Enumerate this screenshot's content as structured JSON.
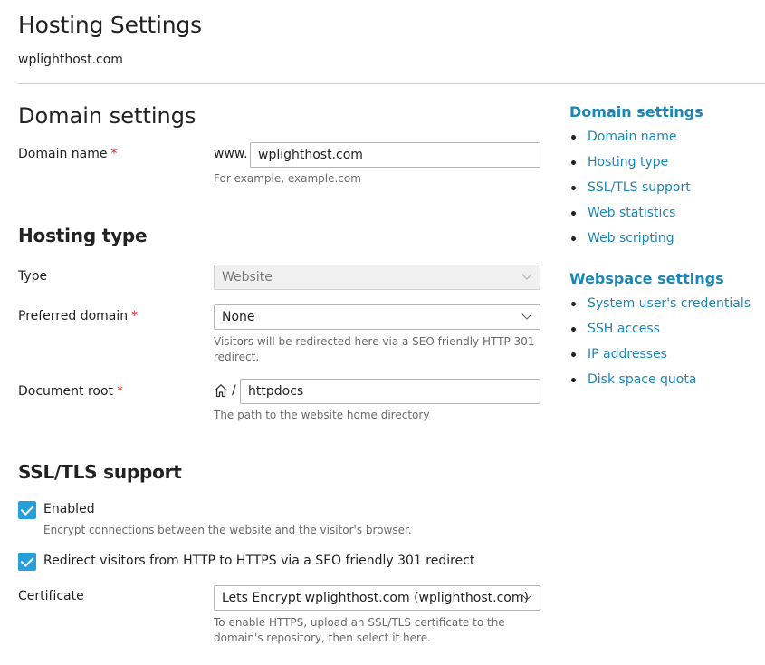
{
  "header": {
    "title": "Hosting Settings",
    "domain": "wplighthost.com"
  },
  "domain_settings": {
    "heading": "Domain settings",
    "domain_name_label": "Domain name",
    "required_mark": "*",
    "www_prefix": "www.",
    "domain_value": "wplighthost.com",
    "domain_hint": "For example, example.com"
  },
  "hosting_type": {
    "heading": "Hosting type",
    "type_label": "Type",
    "type_value": "Website",
    "preferred_label": "Preferred domain",
    "preferred_value": "None",
    "preferred_hint": "Visitors will be redirected here via a SEO friendly HTTP 301 redirect.",
    "docroot_label": "Document root",
    "docroot_slash": "/",
    "docroot_value": "httpdocs",
    "docroot_hint": "The path to the website home directory"
  },
  "ssl": {
    "heading": "SSL/TLS support",
    "enabled_label": "Enabled",
    "enabled_checked": true,
    "enabled_hint": "Encrypt connections between the website and the visitor's browser.",
    "redirect_label": "Redirect visitors from HTTP to HTTPS via a SEO friendly 301 redirect",
    "redirect_checked": true,
    "cert_label": "Certificate",
    "cert_value": "Lets Encrypt wplighthost.com (wplighthost.com)",
    "cert_hint": "To enable HTTPS, upload an SSL/TLS certificate to the domain's repository, then select it here."
  },
  "sidebar": {
    "domain_heading": "Domain settings",
    "domain_links": [
      "Domain name",
      "Hosting type",
      "SSL/TLS support",
      "Web statistics",
      "Web scripting"
    ],
    "webspace_heading": "Webspace settings",
    "webspace_links": [
      "System user's credentials",
      "SSH access",
      "IP addresses",
      "Disk space quota"
    ]
  },
  "colors": {
    "accent": "#1b86b6",
    "checkbox": "#27a0d9",
    "required": "#d02b2b"
  }
}
